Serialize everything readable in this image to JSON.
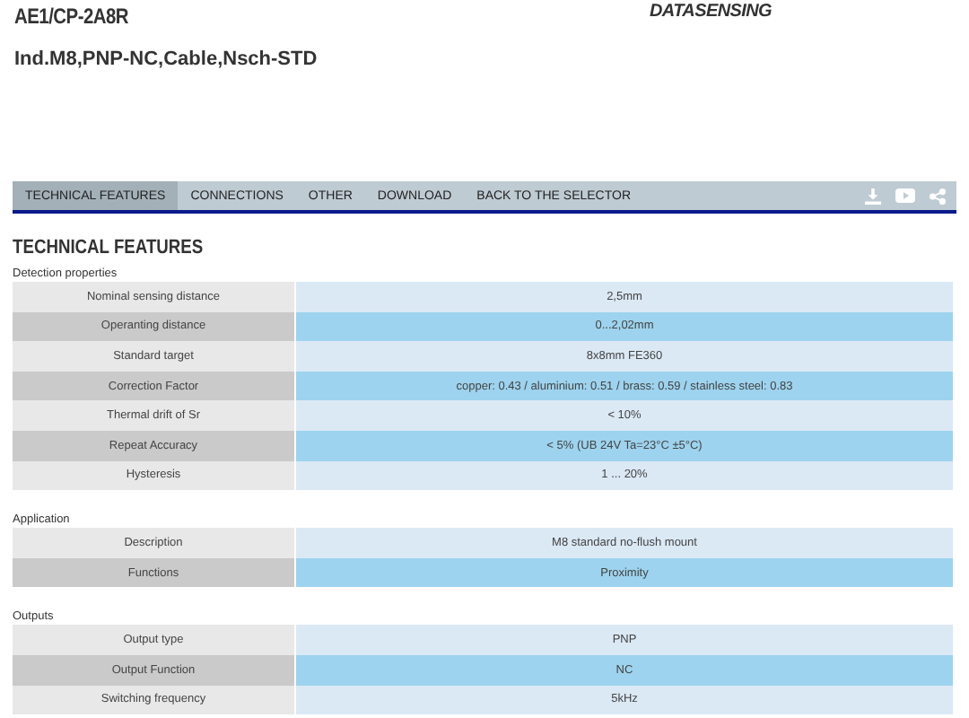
{
  "product": {
    "code": "AE1/CP-2A8R",
    "description": "Ind.M8,PNP-NC,Cable,Nsch-STD",
    "logo": "DATASENSING"
  },
  "tabs": [
    {
      "label": "TECHNICAL FEATURES",
      "selected": true
    },
    {
      "label": "CONNECTIONS",
      "selected": false
    },
    {
      "label": "OTHER",
      "selected": false
    },
    {
      "label": "DOWNLOAD",
      "selected": false
    },
    {
      "label": "BACK TO THE SELECTOR",
      "selected": false
    }
  ],
  "heading": "TECHNICAL FEATURES",
  "sections": [
    {
      "title": "Detection properties",
      "rows": [
        {
          "label": "Nominal sensing distance",
          "value": "2,5mm"
        },
        {
          "label": "Operanting distance",
          "value": "0...2,02mm"
        },
        {
          "label": "Standard target",
          "value": "8x8mm FE360"
        },
        {
          "label": "Correction Factor",
          "value": "copper: 0.43 / aluminium: 0.51 / brass: 0.59 / stainless steel: 0.83"
        },
        {
          "label": "Thermal drift of Sr",
          "value": "< 10%"
        },
        {
          "label": "Repeat Accuracy",
          "value": "< 5% (UB 24V Ta=23°C ±5°C)"
        },
        {
          "label": "Hysteresis",
          "value": "1 ... 20%"
        }
      ]
    },
    {
      "title": "Application",
      "rows": [
        {
          "label": "Description",
          "value": "M8 standard no-flush mount"
        },
        {
          "label": "Functions",
          "value": "Proximity"
        }
      ]
    },
    {
      "title": "Outputs",
      "rows": [
        {
          "label": "Output type",
          "value": "PNP"
        },
        {
          "label": "Output Function",
          "value": "NC"
        },
        {
          "label": "Switching frequency",
          "value": "5kHz"
        }
      ]
    }
  ]
}
